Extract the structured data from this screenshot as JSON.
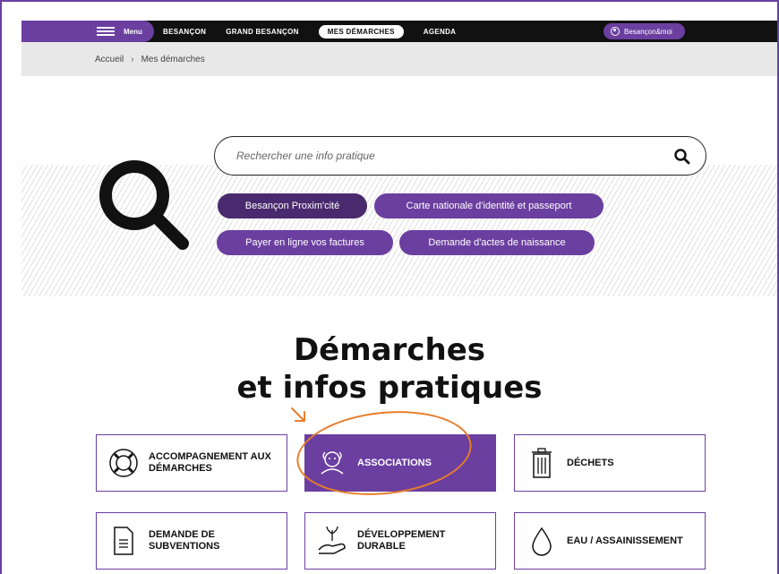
{
  "nav": {
    "menu_label": "Menu",
    "links": [
      "BESANÇON",
      "GRAND BESANÇON",
      "MES DÉMARCHES",
      "AGENDA"
    ],
    "active_index": 2,
    "account_label": "Besançon&moi"
  },
  "breadcrumb": {
    "home": "Accueil",
    "separator": "›",
    "current": "Mes démarches"
  },
  "search": {
    "placeholder": "Rechercher une info pratique"
  },
  "quick_links": [
    "Besançon Proxim'cité",
    "Carte nationale d'identité et passeport",
    "Payer en ligne vos factures",
    "Demande d'actes de naissance"
  ],
  "heading": {
    "line1": "Démarches",
    "line2": "et infos pratiques"
  },
  "cards": [
    {
      "label_1": "ACCOMPAGNEMENT AUX",
      "label_2": "DÉMARCHES",
      "icon": "lifebuoy-icon"
    },
    {
      "label_1": "ASSOCIATIONS",
      "label_2": "",
      "icon": "people-icon",
      "active": true
    },
    {
      "label_1": "DÉCHETS",
      "label_2": "",
      "icon": "trash-icon"
    },
    {
      "label_1": "DEMANDE DE",
      "label_2": "SUBVENTIONS",
      "icon": "document-icon"
    },
    {
      "label_1": "DÉVELOPPEMENT",
      "label_2": "DURABLE",
      "icon": "hand-plant-icon"
    },
    {
      "label_1": "EAU / ASSAINISSEMENT",
      "label_2": "",
      "icon": "water-drop-icon"
    }
  ],
  "colors": {
    "brand_purple": "#6b3fa0",
    "dark_purple": "#4a2a6e",
    "annotation_orange": "#e87d2a"
  }
}
